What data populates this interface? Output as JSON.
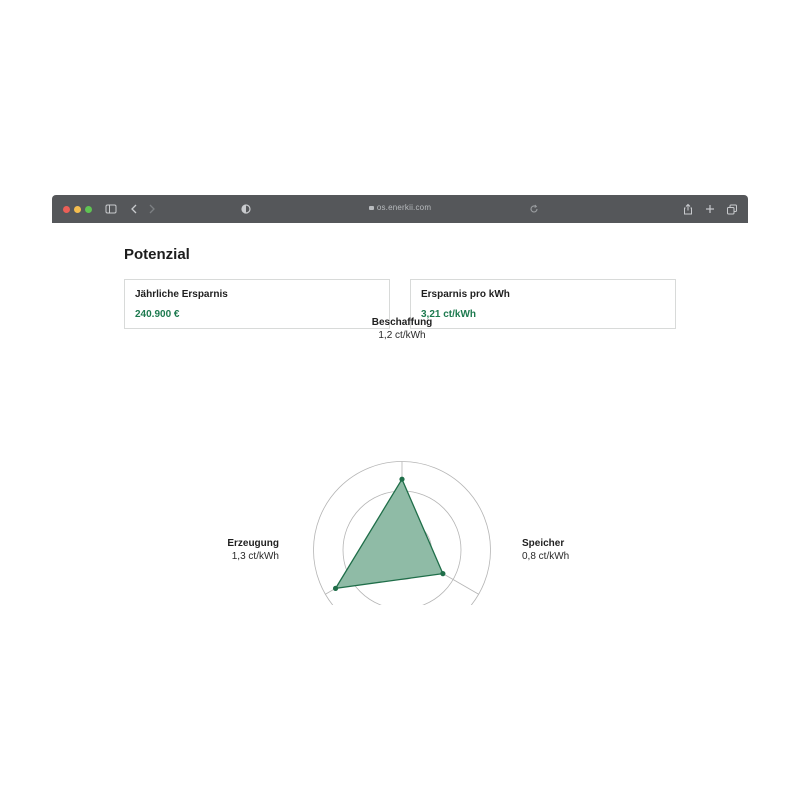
{
  "browser": {
    "url": "os.enerkii.com",
    "colors": {
      "titlebar": "#55575a",
      "close": "#ec5f57",
      "minimize": "#f4bd4f",
      "maximize": "#5fc453"
    }
  },
  "page": {
    "title": "Potenzial"
  },
  "cards": [
    {
      "label": "Jährliche Ersparnis",
      "value": "240.900 €"
    },
    {
      "label": "Ersparnis pro kWh",
      "value": "3,21 ct/kWh"
    }
  ],
  "chart_data": {
    "type": "radar",
    "axes": [
      {
        "name": "Beschaffung",
        "label": "1,2 ct/kWh",
        "value": 1.2
      },
      {
        "name": "Speicher",
        "label": "0,8 ct/kWh",
        "value": 0.8
      },
      {
        "name": "Erzeugung",
        "label": "1,3 ct/kWh",
        "value": 1.3
      }
    ],
    "rings": [
      0.5,
      1.0,
      1.5
    ],
    "colors": {
      "fill": "#8fbba6",
      "stroke": "#1f6e49",
      "point": "#1f6e49",
      "grid": "#b5b5b5"
    }
  }
}
